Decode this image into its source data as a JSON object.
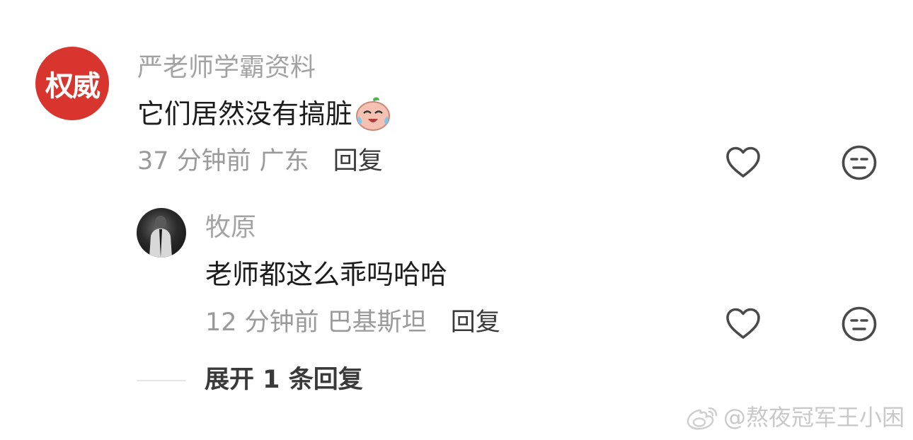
{
  "comment": {
    "avatar_text": "权威",
    "username": "严老师学霸资料",
    "text": "它们居然没有搞脏",
    "emoji": "crying-laughing-peach-emoji",
    "time": "37 分钟前",
    "location": "广东",
    "reply_label": "回复",
    "like_icon": "heart-icon",
    "dislike_icon": "neutral-face-icon"
  },
  "reply": {
    "username": "牧原",
    "text": "老师都这么乖吗哈哈",
    "time": "12 分钟前",
    "location": "巴基斯坦",
    "reply_label": "回复",
    "like_icon": "heart-icon",
    "dislike_icon": "neutral-face-icon"
  },
  "expand": {
    "label": "展开 1 条回复"
  },
  "watermark": {
    "text": "@熬夜冠军王小困",
    "icon": "weibo-logo-icon"
  },
  "colors": {
    "avatar_bg": "#d7352d",
    "meta_gray": "#9a9a9a",
    "username_gray": "#a3a3a3",
    "icon_gray": "#4a4a4a"
  }
}
